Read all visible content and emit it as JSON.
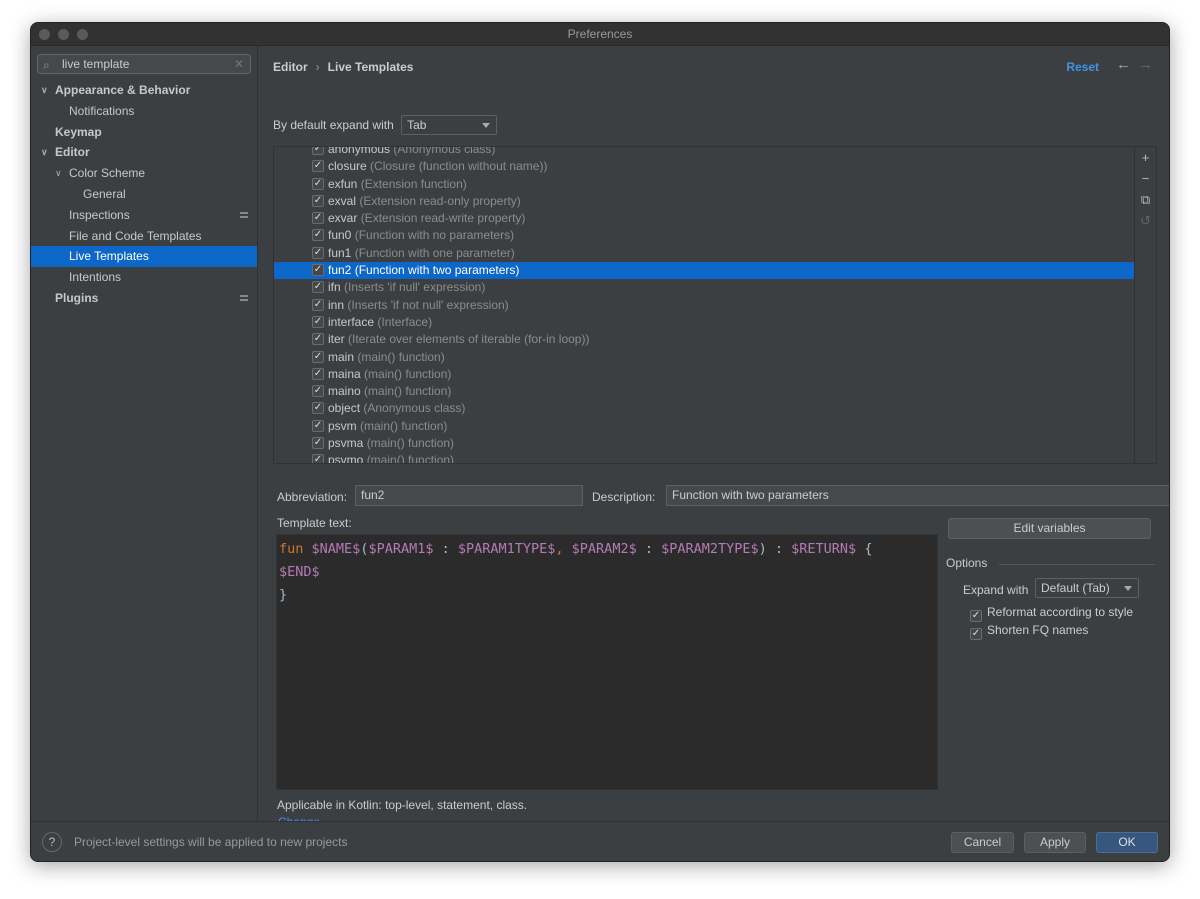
{
  "window": {
    "title": "Preferences"
  },
  "sidebar": {
    "search_value": "live template",
    "items": [
      {
        "label": "Appearance & Behavior",
        "bold": true,
        "level": 0,
        "arrow": "expanded"
      },
      {
        "label": "Notifications",
        "level": 1
      },
      {
        "label": "Keymap",
        "bold": true,
        "level": 0
      },
      {
        "label": "Editor",
        "bold": true,
        "level": 0,
        "arrow": "expanded"
      },
      {
        "label": "Color Scheme",
        "level": 1,
        "arrow": "expanded"
      },
      {
        "label": "General",
        "level": 2
      },
      {
        "label": "Inspections",
        "level": 1,
        "badge": true
      },
      {
        "label": "File and Code Templates",
        "level": 1
      },
      {
        "label": "Live Templates",
        "level": 1,
        "selected": true
      },
      {
        "label": "Intentions",
        "level": 1
      },
      {
        "label": "Plugins",
        "bold": true,
        "level": 0,
        "badge": true
      }
    ]
  },
  "header": {
    "breadcrumb": [
      "Editor",
      "Live Templates"
    ],
    "reset": "Reset"
  },
  "expand": {
    "label": "By default expand with",
    "value": "Tab"
  },
  "templates": [
    {
      "abbr": "anonymous",
      "desc": "(Anonymous class)"
    },
    {
      "abbr": "closure",
      "desc": "(Closure (function without name))"
    },
    {
      "abbr": "exfun",
      "desc": "(Extension function)"
    },
    {
      "abbr": "exval",
      "desc": "(Extension read-only property)"
    },
    {
      "abbr": "exvar",
      "desc": "(Extension read-write property)"
    },
    {
      "abbr": "fun0",
      "desc": "(Function with no parameters)"
    },
    {
      "abbr": "fun1",
      "desc": "(Function with one parameter)"
    },
    {
      "abbr": "fun2",
      "desc": "(Function with two parameters)",
      "selected": true
    },
    {
      "abbr": "ifn",
      "desc": "(Inserts 'if null' expression)"
    },
    {
      "abbr": "inn",
      "desc": "(Inserts 'if not null' expression)"
    },
    {
      "abbr": "interface",
      "desc": "(Interface)"
    },
    {
      "abbr": "iter",
      "desc": "(Iterate over elements of iterable (for-in loop))"
    },
    {
      "abbr": "main",
      "desc": "(main() function)"
    },
    {
      "abbr": "maina",
      "desc": "(main() function)"
    },
    {
      "abbr": "maino",
      "desc": "(main() function)"
    },
    {
      "abbr": "object",
      "desc": "(Anonymous class)"
    },
    {
      "abbr": "psvm",
      "desc": "(main() function)"
    },
    {
      "abbr": "psvma",
      "desc": "(main() function)"
    },
    {
      "abbr": "psvmo",
      "desc": "(main() function)"
    }
  ],
  "detail": {
    "abbreviation_label": "Abbreviation:",
    "abbreviation": "fun2",
    "description_label": "Description:",
    "description": "Function with two parameters",
    "template_text_label": "Template text:",
    "code": {
      "kw": "fun",
      "line1": [
        [
          "var",
          " $NAME$"
        ],
        [
          "pn",
          "("
        ],
        [
          "var",
          "$PARAM1$"
        ],
        [
          "pn",
          " : "
        ],
        [
          "var",
          "$PARAM1TYPE$"
        ],
        [
          "kw",
          ","
        ],
        [
          "var",
          " $PARAM2$"
        ],
        [
          "pn",
          " : "
        ],
        [
          "var",
          "$PARAM2TYPE$"
        ],
        [
          "pn",
          ") : "
        ],
        [
          "var",
          "$RETURN$"
        ],
        [
          "pn",
          " {"
        ]
      ],
      "line2": "$END$",
      "line3": "}"
    },
    "edit_variables": "Edit variables",
    "options_title": "Options",
    "expand_with_label": "Expand with",
    "expand_with_value": "Default (Tab)",
    "reformat": "Reformat according to style",
    "shorten": "Shorten FQ names",
    "applicable": "Applicable in Kotlin: top-level, statement, class.",
    "change": "Change"
  },
  "footer": {
    "note": "Project-level settings will be applied to new projects",
    "cancel": "Cancel",
    "apply": "Apply",
    "ok": "OK"
  }
}
